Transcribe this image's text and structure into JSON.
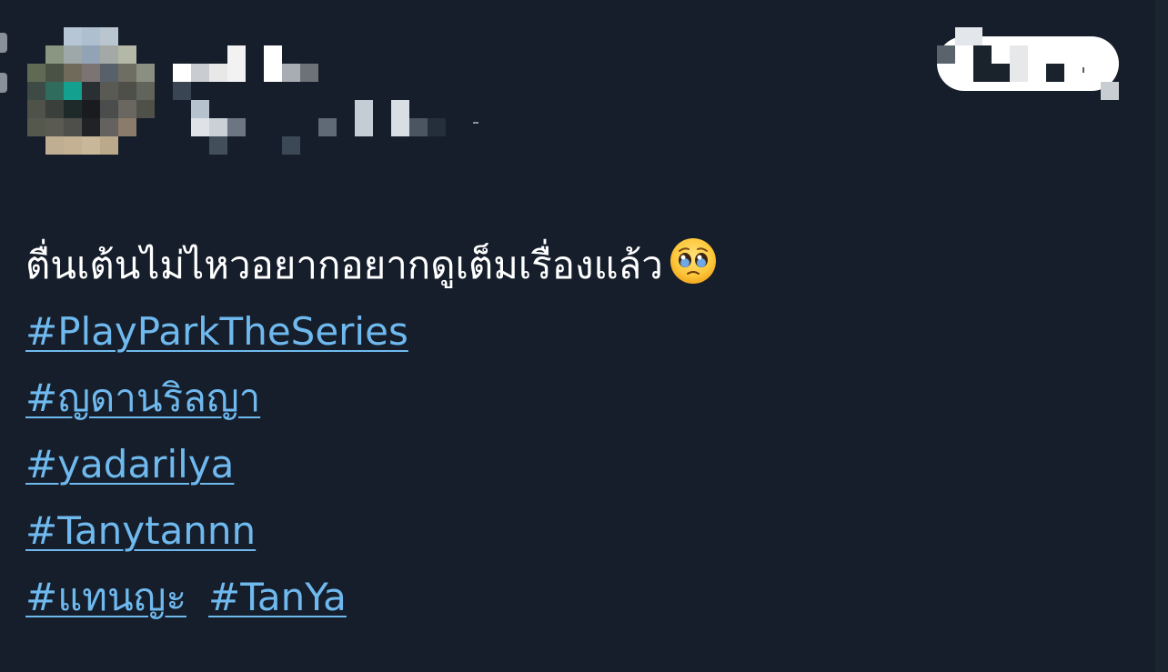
{
  "tweet": {
    "text": "ตื่นเต้นไม่ไหวอยากอยากดูเต็มเรื่องแล้ว",
    "emoji_name": "pleading-face-emoji",
    "hashtag_lines": [
      [
        "#PlayParkTheSeries"
      ],
      [
        "#ญดานริลญา"
      ],
      [
        "#yadarilya"
      ],
      [
        "#Tanytannn"
      ],
      [
        "#แทนญะ",
        "#TanYa"
      ]
    ]
  },
  "colors": {
    "background": "#151e2a",
    "text": "#ffffff",
    "hashtag": "#6fb9ef"
  }
}
